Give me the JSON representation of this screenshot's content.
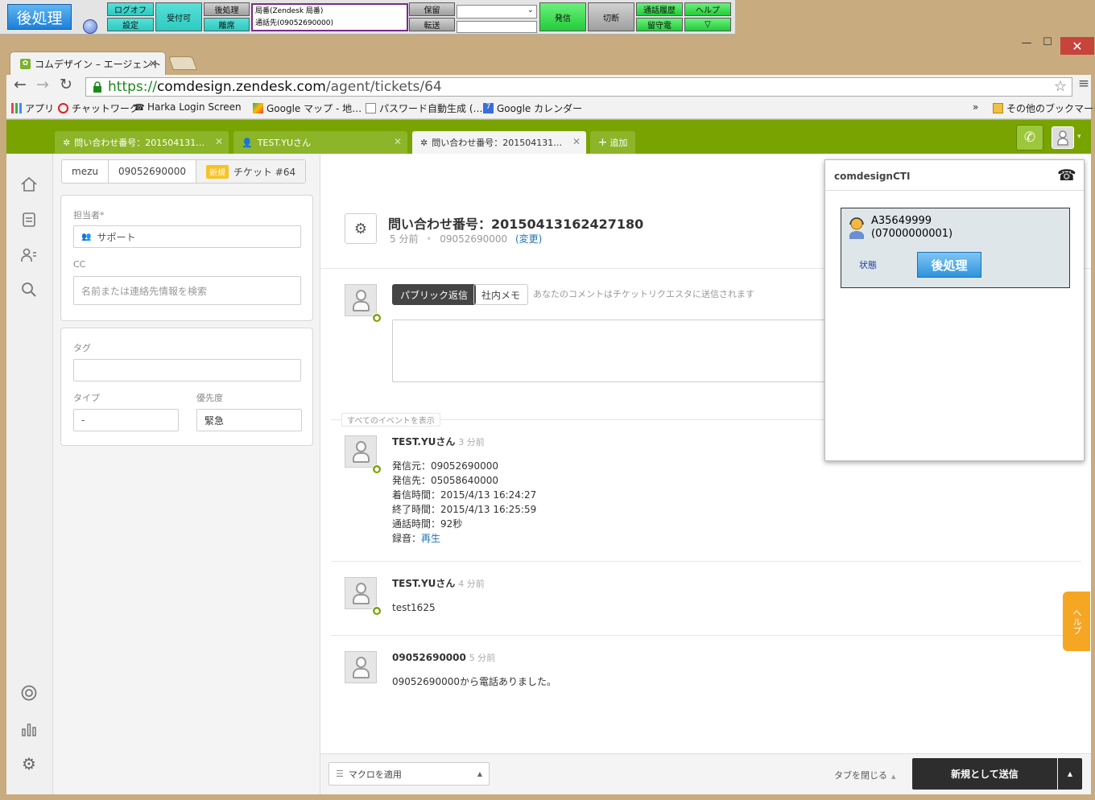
{
  "cti": {
    "logo": "後処理",
    "buttons": {
      "logoff": "ログオフ",
      "settings": "設定",
      "ready": "受付可",
      "wrapup": "後処理",
      "away": "離席",
      "hold": "保留",
      "transfer": "転送",
      "dial": "発信",
      "hangup": "切断",
      "history": "通話履歴",
      "voicemail": "留守電",
      "help": "ヘルプ",
      "more": "▽"
    },
    "status_line1": "局番(Zendesk 局番)",
    "status_line2": "通話先(09052690000)"
  },
  "browser": {
    "tab_title": "コムデザイン – エージェント",
    "url_scheme": "https://",
    "url_host": "comdesign.zendesk.com",
    "url_path": "/agent/tickets/64",
    "bookmarks": [
      "アプリ",
      "チャットワーク",
      "Harka Login Screen",
      "Google マップ - 地…",
      "パスワード自動生成 (…",
      "Google カレンダー"
    ],
    "more_bookmarks": "»",
    "other_bookmarks": "その他のブックマーク"
  },
  "zendesk": {
    "tabs": [
      {
        "label": "問い合わせ番号：201504131…",
        "icon": "gear-icon"
      },
      {
        "label": "TEST.YUさん",
        "icon": "user-icon"
      },
      {
        "label": "問い合わせ番号：201504131…",
        "icon": "gear-icon"
      }
    ],
    "add_tab": "追加",
    "breadcrumb": {
      "org": "mezu",
      "requester": "09052690000",
      "badge": "新規",
      "ticket": "チケット #64"
    },
    "fields": {
      "assignee_label": "担当者*",
      "assignee_value": "サポート",
      "cc_label": "CC",
      "cc_placeholder": "名前または連絡先情報を検索",
      "tags_label": "タグ",
      "type_label": "タイプ",
      "type_value": "-",
      "priority_label": "優先度",
      "priority_value": "緊急"
    },
    "ticket": {
      "subject": "問い合わせ番号：20150413162427180",
      "age": "5 分前",
      "requester": "09052690000",
      "change": "(変更)"
    },
    "composer": {
      "public_reply": "パブリック返信",
      "internal_note": "社内メモ",
      "hint": "あなたのコメントはチケットリクエスタに送信されます"
    },
    "show_all_events": "すべてのイベントを表示",
    "events": [
      {
        "author": "TEST.YUさん",
        "time": "3 分前",
        "lines": [
          "発信元：09052690000",
          "発信先：05058640000",
          "着信時間：2015/4/13 16:24:27",
          "終了時間：2015/4/13 16:25:59",
          "通話時間：92秒"
        ],
        "recording_label": "録音：",
        "recording_link": "再生"
      },
      {
        "author": "TEST.YUさん",
        "time": "4 分前",
        "lines": [
          "test1625"
        ]
      },
      {
        "author": "09052690000",
        "time": "5 分前",
        "lines": [
          "09052690000から電話ありました。"
        ]
      }
    ],
    "bottom": {
      "macro": "マクロを適用",
      "close_tab": "タブを閉じる",
      "submit": "新規として送信"
    },
    "help_tab": "ヘルプ"
  },
  "cti_popup": {
    "title": "comdesignCTI",
    "agent_id": "A35649999",
    "agent_number": "(07000000001)",
    "status_label": "状態",
    "wrapup_button": "後処理"
  },
  "colors": {
    "zendesk_green": "#78a300",
    "cti_teal": "#2ccac0",
    "cti_green": "#22cc3a",
    "submit_dark": "#2d2d2d",
    "help_orange": "#f5a623"
  }
}
